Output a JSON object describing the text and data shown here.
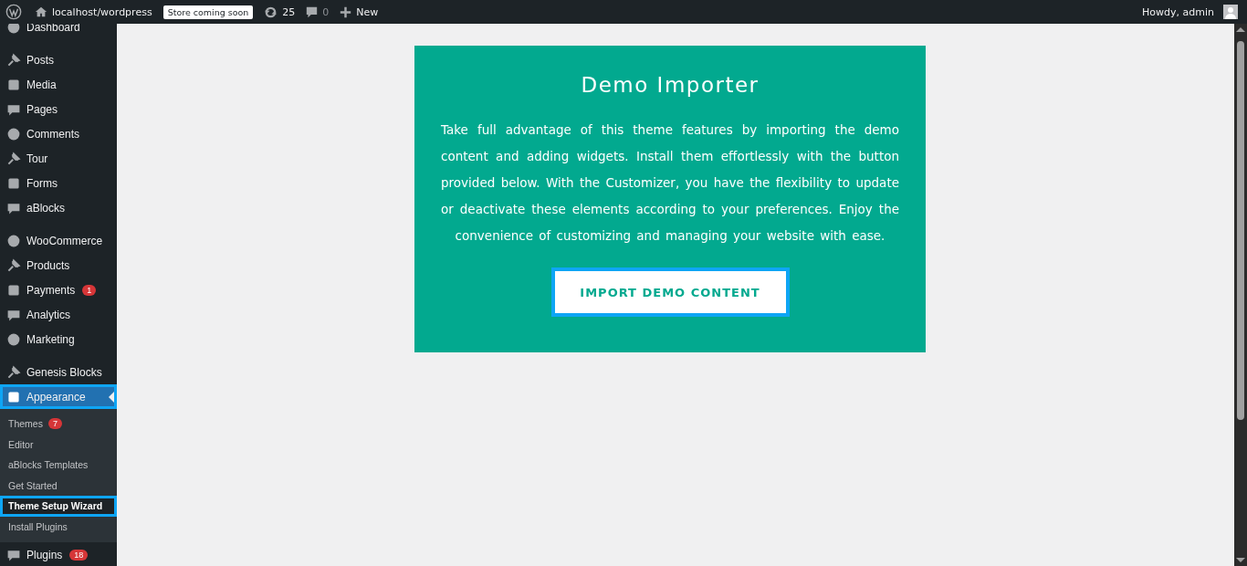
{
  "admin_bar": {
    "site": "localhost/wordpress",
    "store_badge": "Store coming soon",
    "updates": "25",
    "comments": "0",
    "new": "New",
    "greeting": "Howdy, admin"
  },
  "sidebar": {
    "groups": [
      {
        "items": [
          {
            "label": "Dashboard",
            "selected": false,
            "highlighted": false
          }
        ]
      },
      {
        "items": [
          {
            "label": "Posts",
            "selected": false,
            "highlighted": false
          },
          {
            "label": "Media",
            "selected": false,
            "highlighted": false
          },
          {
            "label": "Pages",
            "selected": false,
            "highlighted": false
          },
          {
            "label": "Comments",
            "selected": false,
            "highlighted": false
          },
          {
            "label": "Tour",
            "selected": false,
            "highlighted": false
          },
          {
            "label": "Forms",
            "selected": false,
            "highlighted": false
          },
          {
            "label": "aBlocks",
            "selected": false,
            "highlighted": false
          }
        ]
      },
      {
        "items": [
          {
            "label": "WooCommerce",
            "selected": false,
            "highlighted": false
          },
          {
            "label": "Products",
            "selected": false,
            "highlighted": false
          },
          {
            "label": "Payments",
            "badge": "1",
            "selected": false,
            "highlighted": false
          },
          {
            "label": "Analytics",
            "selected": false,
            "highlighted": false
          },
          {
            "label": "Marketing",
            "selected": false,
            "highlighted": false
          }
        ]
      },
      {
        "items": [
          {
            "label": "Genesis Blocks",
            "selected": false,
            "highlighted": false
          },
          {
            "label": "Appearance",
            "selected": true,
            "highlighted": true,
            "children": [
              {
                "label": "Themes",
                "badge": "7",
                "selected": false,
                "highlighted": false
              },
              {
                "label": "Editor",
                "selected": false,
                "highlighted": false
              },
              {
                "label": "aBlocks Templates",
                "selected": false,
                "highlighted": false
              },
              {
                "label": "Get Started",
                "selected": false,
                "highlighted": false
              },
              {
                "label": "Theme Setup Wizard",
                "selected": true,
                "highlighted": true
              },
              {
                "label": "Install Plugins",
                "selected": false,
                "highlighted": false
              }
            ]
          },
          {
            "label": "Plugins",
            "badge": "18",
            "selected": false,
            "highlighted": false
          }
        ]
      }
    ]
  },
  "card": {
    "title": "Demo Importer",
    "text": "Take full advantage of this theme features by importing the demo content and adding widgets. Install them effortlessly with the button provided below. With the Customizer, you have the flexibility to update or deactivate these elements according to your preferences. Enjoy the convenience of customizing and managing your website with ease.",
    "button": {
      "label": "IMPORT DEMO CONTENT",
      "highlighted": true
    }
  }
}
